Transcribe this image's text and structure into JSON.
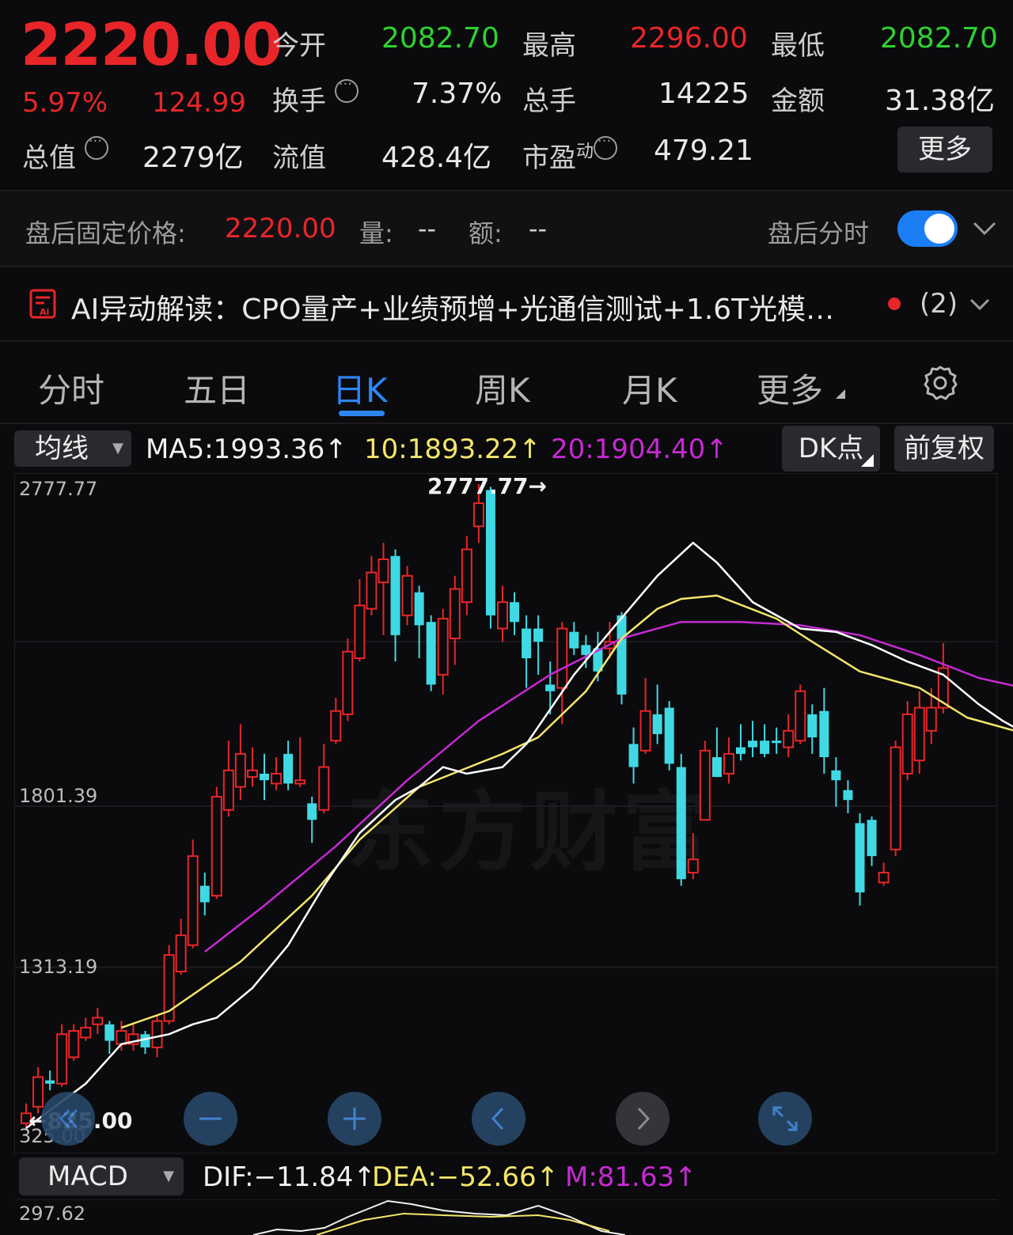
{
  "quote": {
    "price": "2220.00",
    "change_pct": "5.97%",
    "change_abs": "124.99",
    "open_label": "今开",
    "open_value": "2082.70",
    "high_label": "最高",
    "high_value": "2296.00",
    "low_label": "最低",
    "low_value": "2082.70",
    "turnover_label": "换手",
    "turnover_value": "7.37%",
    "volume_label": "总手",
    "volume_value": "14225",
    "amount_label": "金额",
    "amount_value": "31.38亿",
    "mcap_label": "总值",
    "mcap_value": "2279亿",
    "float_label": "流值",
    "float_value": "428.4亿",
    "pe_label": "市盈",
    "pe_sup": "动",
    "pe_value": "479.21",
    "more_button": "更多"
  },
  "after_hours": {
    "label": "盘后固定价格:",
    "price": "2220.00",
    "vol_label": "量:",
    "vol_value": "--",
    "amt_label": "额:",
    "amt_value": "--",
    "toggle_label": "盘后分时",
    "toggle_on": true
  },
  "ai_banner": {
    "text": "AI异动解读：CPO量产+业绩预增+光通信测试+1.6T光模…",
    "count": "(2)"
  },
  "tabs": [
    "分时",
    "五日",
    "日K",
    "周K",
    "月K",
    "更多"
  ],
  "active_tab": "日K",
  "ma_bar": {
    "selector": "均线",
    "ma5": "MA5:1993.36↑",
    "ma10": "10:1893.22↑",
    "ma20": "20:1904.40↑",
    "dk_button": "DK点",
    "adjust_button": "前复权"
  },
  "colors": {
    "up": "#e8262a",
    "down": "#3fd9e4",
    "ma5": "#ffffff",
    "ma10": "#f3e66b",
    "ma20": "#c52ad1",
    "accent": "#1c7ef5"
  },
  "chart_labels": {
    "top": "2777.77",
    "mid": "1801.39",
    "low": "1313.19",
    "bottom": "325.00",
    "max_marker": "2777.77→",
    "min_marker": "←825.00",
    "watermark": "东方财富"
  },
  "controls": [
    "back-icon",
    "zoom-out-icon",
    "zoom-in-icon",
    "prev-icon",
    "next-icon",
    "fullscreen-icon"
  ],
  "macd_bar": {
    "selector": "MACD",
    "dif": "DIF:−11.84↑",
    "dea": "DEA:−52.66↑",
    "m": "M:81.63↑",
    "axis_top": "297.62"
  },
  "chart_data": {
    "type": "candlestick",
    "ylim": [
      825,
      2777.77
    ],
    "candles": [
      {
        "o": 870,
        "c": 840,
        "h": 900,
        "l": 820,
        "up": true
      },
      {
        "o": 890,
        "c": 980,
        "h": 1010,
        "l": 870,
        "up": true
      },
      {
        "o": 960,
        "c": 970,
        "h": 1000,
        "l": 940,
        "up": false
      },
      {
        "o": 960,
        "c": 1110,
        "h": 1140,
        "l": 950,
        "up": true
      },
      {
        "o": 1040,
        "c": 1120,
        "h": 1140,
        "l": 1030,
        "up": true
      },
      {
        "o": 1100,
        "c": 1130,
        "h": 1160,
        "l": 1090,
        "up": true
      },
      {
        "o": 1140,
        "c": 1160,
        "h": 1190,
        "l": 1110,
        "up": true
      },
      {
        "o": 1140,
        "c": 1090,
        "h": 1150,
        "l": 1050,
        "up": false
      },
      {
        "o": 1120,
        "c": 1080,
        "h": 1150,
        "l": 1060,
        "up": true
      },
      {
        "o": 1080,
        "c": 1110,
        "h": 1140,
        "l": 1060,
        "up": true
      },
      {
        "o": 1110,
        "c": 1070,
        "h": 1120,
        "l": 1050,
        "up": false
      },
      {
        "o": 1070,
        "c": 1150,
        "h": 1170,
        "l": 1040,
        "up": true
      },
      {
        "o": 1150,
        "c": 1350,
        "h": 1380,
        "l": 1140,
        "up": true
      },
      {
        "o": 1300,
        "c": 1410,
        "h": 1460,
        "l": 1290,
        "up": true
      },
      {
        "o": 1380,
        "c": 1650,
        "h": 1700,
        "l": 1370,
        "up": true
      },
      {
        "o": 1560,
        "c": 1510,
        "h": 1600,
        "l": 1470,
        "up": false
      },
      {
        "o": 1530,
        "c": 1830,
        "h": 1860,
        "l": 1520,
        "up": true
      },
      {
        "o": 1790,
        "c": 1910,
        "h": 2000,
        "l": 1770,
        "up": true
      },
      {
        "o": 1860,
        "c": 1960,
        "h": 2050,
        "l": 1820,
        "up": true
      },
      {
        "o": 1890,
        "c": 1910,
        "h": 1980,
        "l": 1860,
        "up": true
      },
      {
        "o": 1900,
        "c": 1880,
        "h": 1960,
        "l": 1820,
        "up": false
      },
      {
        "o": 1900,
        "c": 1870,
        "h": 1950,
        "l": 1850,
        "up": true
      },
      {
        "o": 1960,
        "c": 1870,
        "h": 2000,
        "l": 1850,
        "up": false
      },
      {
        "o": 1870,
        "c": 1880,
        "h": 2010,
        "l": 1860,
        "up": true
      },
      {
        "o": 1810,
        "c": 1760,
        "h": 1830,
        "l": 1690,
        "up": false
      },
      {
        "o": 1790,
        "c": 1920,
        "h": 1990,
        "l": 1780,
        "up": true
      },
      {
        "o": 2000,
        "c": 2090,
        "h": 2130,
        "l": 1990,
        "up": true
      },
      {
        "o": 2080,
        "c": 2270,
        "h": 2310,
        "l": 2060,
        "up": true
      },
      {
        "o": 2250,
        "c": 2410,
        "h": 2490,
        "l": 2240,
        "up": true
      },
      {
        "o": 2400,
        "c": 2510,
        "h": 2560,
        "l": 2380,
        "up": true
      },
      {
        "o": 2480,
        "c": 2550,
        "h": 2600,
        "l": 2320,
        "up": true
      },
      {
        "o": 2560,
        "c": 2320,
        "h": 2580,
        "l": 2240,
        "up": false
      },
      {
        "o": 2380,
        "c": 2500,
        "h": 2530,
        "l": 2350,
        "up": true
      },
      {
        "o": 2450,
        "c": 2350,
        "h": 2470,
        "l": 2250,
        "up": false
      },
      {
        "o": 2360,
        "c": 2170,
        "h": 2380,
        "l": 2150,
        "up": false
      },
      {
        "o": 2200,
        "c": 2370,
        "h": 2400,
        "l": 2140,
        "up": true
      },
      {
        "o": 2310,
        "c": 2460,
        "h": 2500,
        "l": 2230,
        "up": true
      },
      {
        "o": 2420,
        "c": 2580,
        "h": 2620,
        "l": 2380,
        "up": true
      },
      {
        "o": 2650,
        "c": 2720,
        "h": 2777.77,
        "l": 2600,
        "up": true
      },
      {
        "o": 2760,
        "c": 2380,
        "h": 2770,
        "l": 2340,
        "up": false
      },
      {
        "o": 2420,
        "c": 2340,
        "h": 2470,
        "l": 2300,
        "up": true
      },
      {
        "o": 2420,
        "c": 2360,
        "h": 2450,
        "l": 2320,
        "up": false
      },
      {
        "o": 2340,
        "c": 2250,
        "h": 2380,
        "l": 2160,
        "up": false
      },
      {
        "o": 2340,
        "c": 2300,
        "h": 2380,
        "l": 2200,
        "up": false
      },
      {
        "o": 2170,
        "c": 2150,
        "h": 2240,
        "l": 2080,
        "up": false
      },
      {
        "o": 2160,
        "c": 2340,
        "h": 2360,
        "l": 2050,
        "up": true
      },
      {
        "o": 2330,
        "c": 2280,
        "h": 2360,
        "l": 2260,
        "up": false
      },
      {
        "o": 2290,
        "c": 2260,
        "h": 2320,
        "l": 2220,
        "up": false
      },
      {
        "o": 2280,
        "c": 2210,
        "h": 2330,
        "l": 2180,
        "up": false
      },
      {
        "o": 2280,
        "c": 2300,
        "h": 2360,
        "l": 2250,
        "up": true
      },
      {
        "o": 2380,
        "c": 2140,
        "h": 2390,
        "l": 2110,
        "up": false
      },
      {
        "o": 1990,
        "c": 1920,
        "h": 2040,
        "l": 1870,
        "up": false
      },
      {
        "o": 1970,
        "c": 2090,
        "h": 2190,
        "l": 1960,
        "up": true
      },
      {
        "o": 2080,
        "c": 2020,
        "h": 2170,
        "l": 1990,
        "up": false
      },
      {
        "o": 2100,
        "c": 1930,
        "h": 2120,
        "l": 1910,
        "up": false
      },
      {
        "o": 1920,
        "c": 1580,
        "h": 1960,
        "l": 1560,
        "up": false
      },
      {
        "o": 1640,
        "c": 1600,
        "h": 1720,
        "l": 1580,
        "up": true
      },
      {
        "o": 1760,
        "c": 1970,
        "h": 2000,
        "l": 1760,
        "up": true
      },
      {
        "o": 1950,
        "c": 1890,
        "h": 2040,
        "l": 1890,
        "up": false
      },
      {
        "o": 1900,
        "c": 1960,
        "h": 2010,
        "l": 1870,
        "up": true
      },
      {
        "o": 1980,
        "c": 1960,
        "h": 2050,
        "l": 1940,
        "up": false
      },
      {
        "o": 2000,
        "c": 1980,
        "h": 2060,
        "l": 1950,
        "up": false
      },
      {
        "o": 1960,
        "c": 2000,
        "h": 2050,
        "l": 1950,
        "up": false
      },
      {
        "o": 2000,
        "c": 2000,
        "h": 2040,
        "l": 1960,
        "up": false
      },
      {
        "o": 1980,
        "c": 2030,
        "h": 2080,
        "l": 1950,
        "up": true
      },
      {
        "o": 2000,
        "c": 2150,
        "h": 2170,
        "l": 1990,
        "up": true
      },
      {
        "o": 2010,
        "c": 2080,
        "h": 2110,
        "l": 1960,
        "up": false
      },
      {
        "o": 2090,
        "c": 1950,
        "h": 2160,
        "l": 1900,
        "up": false
      },
      {
        "o": 1910,
        "c": 1880,
        "h": 1950,
        "l": 1800,
        "up": false
      },
      {
        "o": 1850,
        "c": 1820,
        "h": 1880,
        "l": 1780,
        "up": false
      },
      {
        "o": 1750,
        "c": 1540,
        "h": 1780,
        "l": 1500,
        "up": false
      },
      {
        "o": 1760,
        "c": 1650,
        "h": 1770,
        "l": 1620,
        "up": false
      },
      {
        "o": 1600,
        "c": 1570,
        "h": 1630,
        "l": 1560,
        "up": true
      },
      {
        "o": 1670,
        "c": 1980,
        "h": 2000,
        "l": 1650,
        "up": true
      },
      {
        "o": 1900,
        "c": 2080,
        "h": 2120,
        "l": 1880,
        "up": true
      },
      {
        "o": 1940,
        "c": 2100,
        "h": 2150,
        "l": 1900,
        "up": true
      },
      {
        "o": 2030,
        "c": 2100,
        "h": 2160,
        "l": 1990,
        "up": true
      },
      {
        "o": 2100,
        "c": 2220,
        "h": 2296,
        "l": 2082.7,
        "up": true
      }
    ],
    "ma5": [
      [
        825,
        0
      ],
      [
        960,
        5
      ],
      [
        1080,
        8
      ],
      [
        1110,
        12
      ],
      [
        1140,
        14
      ],
      [
        1160,
        16
      ],
      [
        1250,
        19
      ],
      [
        1380,
        22
      ],
      [
        1560,
        25
      ],
      [
        1720,
        28
      ],
      [
        1820,
        31
      ],
      [
        1860,
        33
      ],
      [
        1920,
        35
      ],
      [
        1900,
        37
      ],
      [
        1920,
        40
      ],
      [
        1990,
        42
      ],
      [
        2200,
        46
      ],
      [
        2330,
        49
      ],
      [
        2500,
        53
      ],
      [
        2600,
        56
      ],
      [
        2540,
        58
      ],
      [
        2420,
        61
      ],
      [
        2340,
        65
      ],
      [
        2330,
        68
      ],
      [
        2290,
        71
      ],
      [
        2240,
        74
      ],
      [
        2200,
        77
      ],
      [
        2110,
        80
      ],
      [
        2060,
        82
      ],
      [
        2000,
        85
      ],
      [
        1880,
        87
      ],
      [
        1860,
        89
      ],
      [
        2040,
        91
      ],
      [
        2020,
        93
      ],
      [
        1960,
        95
      ],
      [
        1900,
        97
      ],
      [
        1720,
        100
      ],
      [
        1780,
        102
      ],
      [
        1960,
        104
      ]
    ],
    "ma10": [
      [
        1130,
        8
      ],
      [
        1180,
        12
      ],
      [
        1330,
        18
      ],
      [
        1530,
        24
      ],
      [
        1700,
        28
      ],
      [
        1860,
        33
      ],
      [
        1960,
        40
      ],
      [
        2010,
        43
      ],
      [
        2150,
        47
      ],
      [
        2310,
        50
      ],
      [
        2400,
        53
      ],
      [
        2430,
        55
      ],
      [
        2440,
        58
      ],
      [
        2370,
        63
      ],
      [
        2300,
        66
      ],
      [
        2210,
        70
      ],
      [
        2160,
        75
      ],
      [
        2070,
        79
      ],
      [
        2030,
        83
      ],
      [
        1990,
        88
      ],
      [
        1950,
        92
      ],
      [
        1940,
        96
      ],
      [
        1920,
        99
      ],
      [
        1940,
        103
      ],
      [
        1990,
        104
      ]
    ],
    "ma20": [
      [
        1360,
        15
      ],
      [
        1500,
        20
      ],
      [
        1680,
        26
      ],
      [
        1880,
        32
      ],
      [
        2060,
        38
      ],
      [
        2200,
        44
      ],
      [
        2310,
        50
      ],
      [
        2360,
        55
      ],
      [
        2360,
        60
      ],
      [
        2350,
        65
      ],
      [
        2320,
        70
      ],
      [
        2260,
        75
      ],
      [
        2190,
        80
      ],
      [
        2150,
        85
      ],
      [
        2070,
        90
      ],
      [
        2020,
        95
      ],
      [
        1980,
        100
      ],
      [
        1980,
        104
      ]
    ]
  }
}
